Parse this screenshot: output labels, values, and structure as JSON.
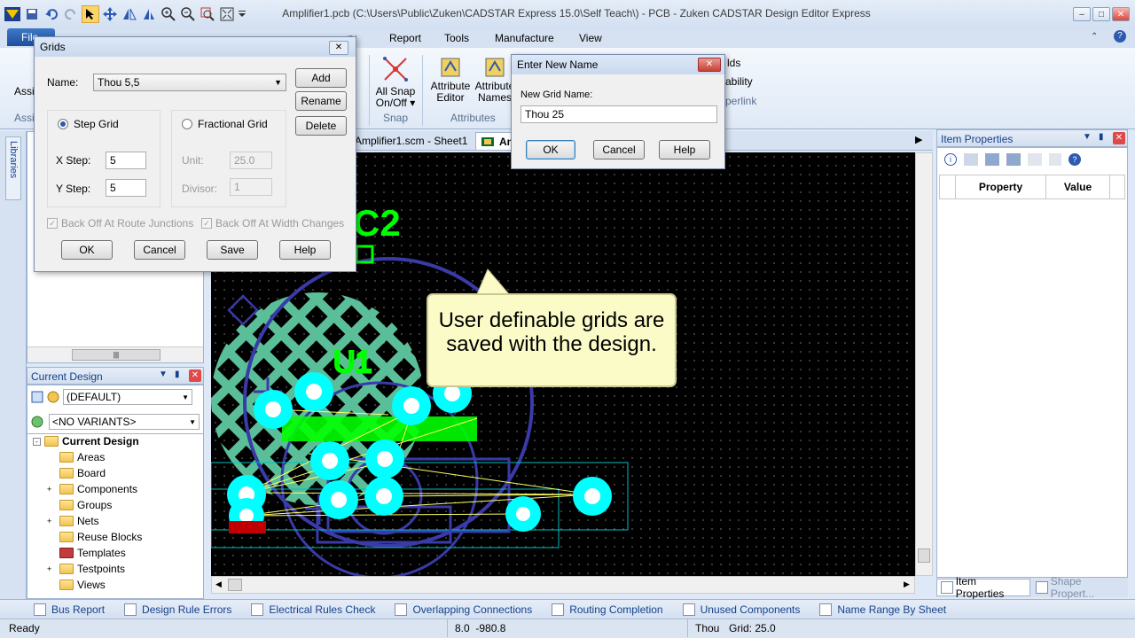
{
  "app": {
    "title": "Amplifier1.pcb (C:\\Users\\Public\\Zuken\\CADSTAR Express 15.0\\Self Teach\\) - PCB - Zuken CADSTAR Design Editor Express"
  },
  "ribbon": {
    "tabs": [
      "File",
      "ry",
      "Report",
      "Tools",
      "Manufacture",
      "View"
    ],
    "snap_button": [
      "All Snap",
      "On/Off ▾"
    ],
    "snap_group": "Snap",
    "attr_editor": [
      "Attribute",
      "Editor"
    ],
    "attr_names": [
      "Attribute",
      "Names"
    ],
    "attributes_group": "Attributes",
    "cut_labels": [
      "Assi",
      "Assi",
      "lds",
      "ability",
      "perlink"
    ]
  },
  "tabs": {
    "doc1": "Amplifier1.scm - Sheet1",
    "doc2": "Am"
  },
  "left": {
    "libraries_label": "Libraries",
    "scroll_thumb": "|||"
  },
  "current_design": {
    "header": "Current Design",
    "variant_select": "(DEFAULT)",
    "variants_select": "<NO VARIANTS>",
    "tree_root": "Current Design",
    "tree_items": [
      "Areas",
      "Board",
      "Components",
      "Groups",
      "Nets",
      "Reuse Blocks",
      "Templates",
      "Testpoints",
      "Views"
    ]
  },
  "grids_dialog": {
    "title": "Grids",
    "name_label": "Name:",
    "name_value": "Thou 5,5",
    "add": "Add",
    "rename": "Rename",
    "delete": "Delete",
    "step_grid": "Step Grid",
    "fractional_grid": "Fractional Grid",
    "x_step_label": "X Step:",
    "x_step": "5",
    "y_step_label": "Y Step:",
    "y_step": "5",
    "unit_label": "Unit:",
    "unit_value": "25.0",
    "divisor_label": "Divisor:",
    "divisor_value": "1",
    "backoff_route": "Back Off At Route Junctions",
    "backoff_width": "Back Off At Width Changes",
    "ok": "OK",
    "cancel": "Cancel",
    "save": "Save",
    "help": "Help"
  },
  "rename_dialog": {
    "title": "Enter New Name",
    "label": "New Grid Name:",
    "value": "Thou 25",
    "ok": "OK",
    "cancel": "Cancel",
    "help": "Help"
  },
  "pcb": {
    "silk_label_c2": "C2",
    "silk_label_u1": "U1",
    "callout": "User definable grids are saved with the design."
  },
  "item_properties": {
    "header": "Item Properties",
    "col_property": "Property",
    "col_value": "Value",
    "tab1": "Item Properties",
    "tab2": "Shape Propert..."
  },
  "bottom_tabs": [
    "Bus Report",
    "Design Rule Errors",
    "Electrical Rules Check",
    "Overlapping Connections",
    "Routing Completion",
    "Unused Components",
    "Name Range By Sheet"
  ],
  "status": {
    "ready": "Ready",
    "coords": "8.0  -980.8",
    "units": "Thou",
    "grid": "Grid: 25.0"
  },
  "colors": {
    "pcb_background": "#000000",
    "copper_pad": "#00ffff",
    "silkscreen": "#00ff00",
    "copper_pour": "#5fc9a0",
    "board_outline": "#3a3aa8",
    "callout_bg": "#fbfbc8"
  }
}
